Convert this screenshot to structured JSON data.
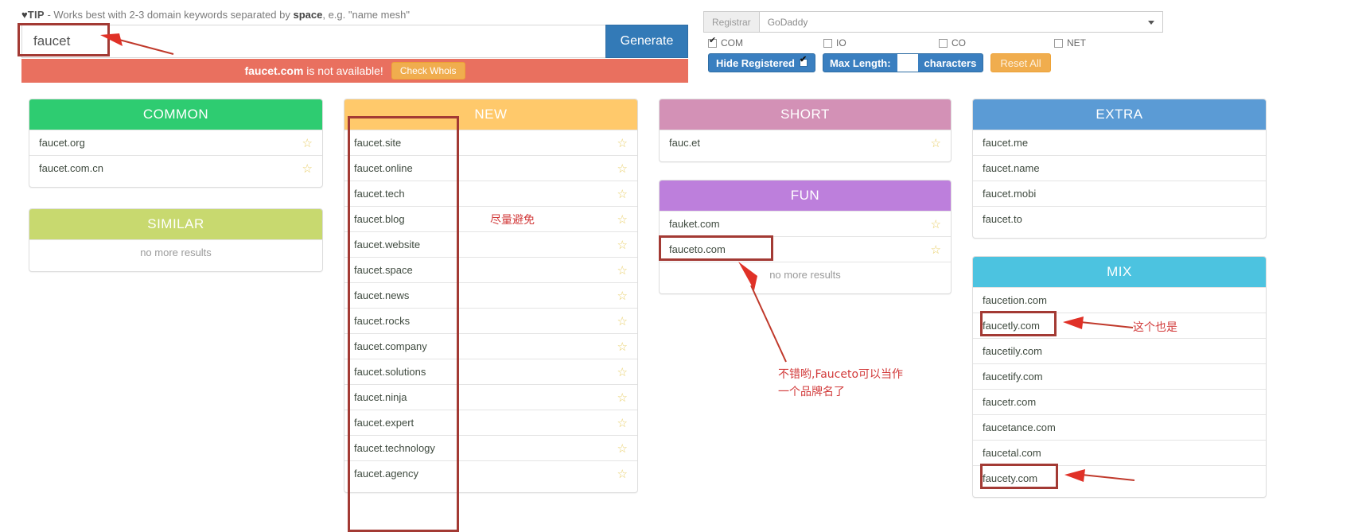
{
  "tip": {
    "icon": "lightbulb-icon",
    "label": "TIP",
    "text_before": " - Works best with 2-3 domain keywords separated by ",
    "keyword": "space",
    "text_after": ", e.g. \"name mesh\""
  },
  "search": {
    "value": "faucet",
    "placeholder": "",
    "generate_label": "Generate"
  },
  "alert": {
    "domain": "faucet.com",
    "message": " is not available!",
    "whois_label": "Check Whois"
  },
  "controls": {
    "registrar_label": "Registrar",
    "registrar_value": "GoDaddy",
    "tlds": [
      {
        "label": "COM",
        "checked": true
      },
      {
        "label": "IO",
        "checked": false
      },
      {
        "label": "CO",
        "checked": false
      },
      {
        "label": "NET",
        "checked": false
      }
    ],
    "hide_registered_label": "Hide Registered",
    "hide_registered_checked": true,
    "max_length_label": "Max Length:",
    "max_length_value": "",
    "characters_label": "characters",
    "reset_label": "Reset All"
  },
  "colors": {
    "common": "#2ecc71",
    "similar": "#c8d96f",
    "new": "#ffc96b",
    "short": "#d391b6",
    "fun": "#bd7fdc",
    "extra": "#5b9bd5",
    "mix": "#4cc3e0",
    "accent_blue": "#337ab7",
    "alert_red": "#e9705f",
    "warn_orange": "#f0ad4e",
    "annotation_red": "#d23a3a",
    "anno_box_red": "#a33a34",
    "star_gold": "#e9cf6a"
  },
  "cards": [
    {
      "id": "common",
      "title": "COMMON",
      "items": [
        {
          "domain": "faucet.org",
          "star": "★"
        },
        {
          "domain": "faucet.com.cn",
          "star": "★"
        }
      ],
      "empty": null
    },
    {
      "id": "similar",
      "title": "SIMILAR",
      "items": [],
      "empty": "no more results"
    },
    {
      "id": "new",
      "title": "NEW",
      "items": [
        {
          "domain": "faucet.site",
          "star": "★"
        },
        {
          "domain": "faucet.online",
          "star": "★"
        },
        {
          "domain": "faucet.tech",
          "star": "★"
        },
        {
          "domain": "faucet.blog",
          "star": "★"
        },
        {
          "domain": "faucet.website",
          "star": "★"
        },
        {
          "domain": "faucet.space",
          "star": "★"
        },
        {
          "domain": "faucet.news",
          "star": "★"
        },
        {
          "domain": "faucet.rocks",
          "star": "★"
        },
        {
          "domain": "faucet.company",
          "star": "★"
        },
        {
          "domain": "faucet.solutions",
          "star": "★"
        },
        {
          "domain": "faucet.ninja",
          "star": "★"
        },
        {
          "domain": "faucet.expert",
          "star": "★"
        },
        {
          "domain": "faucet.technology",
          "star": "★"
        },
        {
          "domain": "faucet.agency",
          "star": "★"
        }
      ],
      "empty": null
    },
    {
      "id": "short",
      "title": "SHORT",
      "items": [
        {
          "domain": "fauc.et",
          "star": "★"
        }
      ],
      "empty": null
    },
    {
      "id": "fun",
      "title": "FUN",
      "items": [
        {
          "domain": "fauket.com",
          "star": "★"
        },
        {
          "domain": "fauceto.com",
          "star": "★"
        }
      ],
      "empty": "no more results"
    },
    {
      "id": "extra",
      "title": "EXTRA",
      "items": [
        {
          "domain": "faucet.me",
          "star": ""
        },
        {
          "domain": "faucet.name",
          "star": ""
        },
        {
          "domain": "faucet.mobi",
          "star": ""
        },
        {
          "domain": "faucet.to",
          "star": ""
        }
      ],
      "empty": null
    },
    {
      "id": "mix",
      "title": "MIX",
      "items": [
        {
          "domain": "faucetion.com",
          "star": ""
        },
        {
          "domain": "faucetly.com",
          "star": ""
        },
        {
          "domain": "faucetily.com",
          "star": ""
        },
        {
          "domain": "faucetify.com",
          "star": ""
        },
        {
          "domain": "faucetr.com",
          "star": ""
        },
        {
          "domain": "faucetance.com",
          "star": ""
        },
        {
          "domain": "faucetal.com",
          "star": ""
        },
        {
          "domain": "faucety.com",
          "star": ""
        }
      ],
      "empty": null
    }
  ],
  "annotations": {
    "avoid": "尽量避免",
    "brand": "不错哟,Fauceto可以当作\n一个品牌名了",
    "also": "这个也是"
  }
}
